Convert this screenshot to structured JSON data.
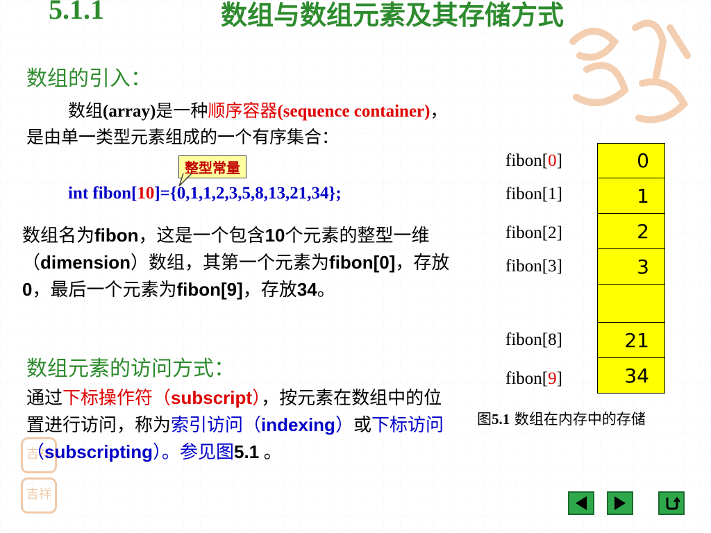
{
  "title": {
    "number": "5.1.1",
    "text": "数组与数组元素及其存储方式"
  },
  "intro": {
    "heading": "数组的引入：",
    "p1_a": "数组",
    "p1_b": "(array)",
    "p1_c": "是一种",
    "p1_red": "顺序容器",
    "p1_red2": "(sequence container)",
    "p1_d": "，是由单一类型元素组成的一个有序集合：",
    "code_pre": "int fibon[",
    "code_num": "10",
    "code_post": "]={0,1,1,2,3,5,8,13,21,34};",
    "callout": "整型常量"
  },
  "description": {
    "s1": "数组名为",
    "fibon": "fibon",
    "s2": "，这是一个包含",
    "ten": "10",
    "s3": "个元素的整型一维（",
    "dimension": "dimension",
    "s4": "）数组，其第一个元素为",
    "fibon0": "fibon[0]",
    "s5": "，存放",
    "zero": "0",
    "s6": "，最后一个元素为",
    "fibon9": "fibon[9]",
    "s7": "，存放",
    "val34": "34",
    "s8": "。"
  },
  "access": {
    "heading": "数组元素的访问方式：",
    "s1": "通过",
    "red1": "下标操作符（",
    "subscript": "subscript",
    "red2": "）",
    "s2": "，按元素在数组中的位置进行访问，称为",
    "blue1": "索引访问（",
    "indexing": "indexing",
    "blue2": "）",
    "s3": "或",
    "blue3": "下标访问",
    "s4": "（",
    "subscripting": "subscripting",
    "s5": "）。参见图",
    "fig": "5.1",
    "s6": " 。"
  },
  "memory": {
    "labels": [
      {
        "prefix": "fibon[",
        "index": "0",
        "suffix": "]",
        "index_red": true
      },
      {
        "prefix": "fibon[",
        "index": "1",
        "suffix": "]",
        "index_red": false
      },
      {
        "prefix": "fibon[",
        "index": "2",
        "suffix": "]",
        "index_red": false
      },
      {
        "prefix": "fibon[",
        "index": "3",
        "suffix": "]",
        "index_red": false
      },
      {
        "prefix": "fibon[",
        "index": "8",
        "suffix": "]",
        "index_red": false
      },
      {
        "prefix": "fibon[",
        "index": "9",
        "suffix": "]",
        "index_red": true
      }
    ],
    "cells": [
      "0",
      "1",
      "2",
      "3",
      "",
      "21",
      "34"
    ],
    "caption_prefix": "图",
    "caption_num": "5.1",
    "caption_text": " 数组在内存中的存储"
  },
  "nav": {
    "prev_icon": "triangle-left-icon",
    "next_icon": "triangle-right-icon",
    "return_icon": "return-arrow-icon"
  },
  "decor": {
    "seal_text": "吉祥"
  },
  "colors": {
    "heading_green": "#2e8b2e",
    "highlight_red": "#e00000",
    "code_blue": "#0000c8",
    "cell_yellow": "#ffff00",
    "nav_green": "#2ea84a"
  }
}
